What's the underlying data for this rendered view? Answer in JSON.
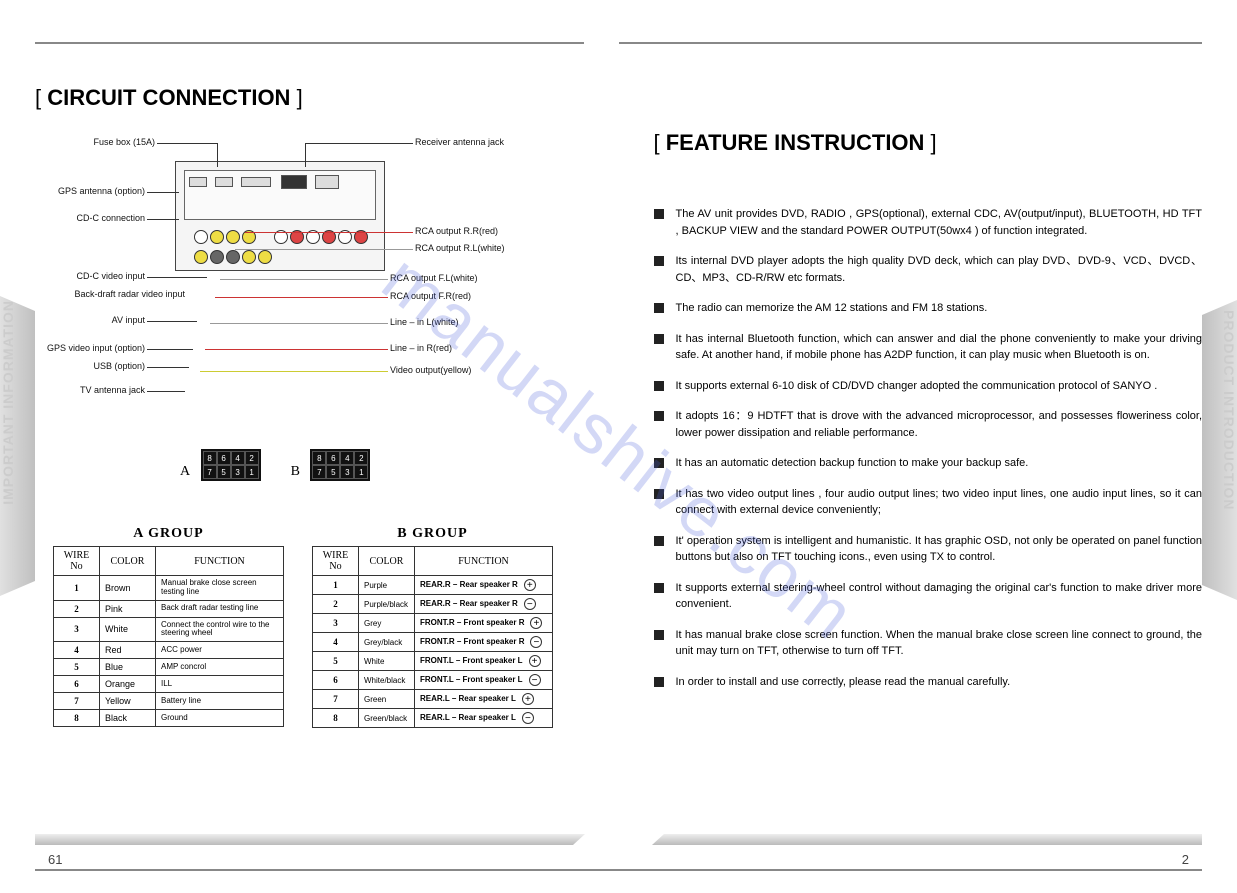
{
  "leftTitle": "CIRCUIT CONNECTION",
  "rightTitle": "FEATURE INSTRUCTION",
  "sideLeft": "IMPORTANT   INFORMATION",
  "sideRight": "PRODUCT INTRODUCTION",
  "pageLeft": "61",
  "pageRight": "2",
  "watermark": "manualshive.com",
  "labelsLeft": [
    "Fuse box (15A)",
    "GPS antenna (option)",
    "CD-C connection",
    "CD-C video input",
    "Back-draft radar video input",
    "AV input",
    "GPS video input (option)",
    "USB (option)",
    "TV antenna jack"
  ],
  "labelsRight": [
    "Receiver antenna jack",
    "RCA output R.R(red)",
    "RCA output R.L(white)",
    "RCA output F.L(white)",
    "RCA output F.R(red)",
    "Line – in L(white)",
    "Line – in R(red)",
    "Video output(yellow)"
  ],
  "connA": "A",
  "connB": "B",
  "pinsTop": [
    "8",
    "6",
    "4",
    "2"
  ],
  "pinsBot": [
    "7",
    "5",
    "3",
    "1"
  ],
  "groupA": {
    "title": "A GROUP",
    "headers": [
      "WIRE No",
      "COLOR",
      "FUNCTION"
    ],
    "rows": [
      {
        "no": "1",
        "color": "Brown",
        "func": "Manual brake close screen testing line"
      },
      {
        "no": "2",
        "color": "Pink",
        "func": "Back draft radar testing line"
      },
      {
        "no": "3",
        "color": "White",
        "func": "Connect the control wire to the steering wheel"
      },
      {
        "no": "4",
        "color": "Red",
        "func": "ACC power"
      },
      {
        "no": "5",
        "color": "Blue",
        "func": "AMP concrol"
      },
      {
        "no": "6",
        "color": "Orange",
        "func": "ILL"
      },
      {
        "no": "7",
        "color": "Yellow",
        "func": "Battery line"
      },
      {
        "no": "8",
        "color": "Black",
        "func": "Ground"
      }
    ]
  },
  "groupB": {
    "title": "B GROUP",
    "headers": [
      "WIRE No",
      "COLOR",
      "FUNCTION"
    ],
    "rows": [
      {
        "no": "1",
        "color": "Purple",
        "func": "REAR.R – Rear speaker R",
        "sym": "+"
      },
      {
        "no": "2",
        "color": "Purple/black",
        "func": "REAR.R – Rear speaker R",
        "sym": "−"
      },
      {
        "no": "3",
        "color": "Grey",
        "func": "FRONT.R – Front speaker R",
        "sym": "+"
      },
      {
        "no": "4",
        "color": "Grey/black",
        "func": "FRONT.R – Front speaker R",
        "sym": "−"
      },
      {
        "no": "5",
        "color": "White",
        "func": "FRONT.L – Front speaker L",
        "sym": "+"
      },
      {
        "no": "6",
        "color": "White/black",
        "func": "FRONT.L – Front speaker L",
        "sym": "−"
      },
      {
        "no": "7",
        "color": "Green",
        "func": "REAR.L – Rear speaker L",
        "sym": "+"
      },
      {
        "no": "8",
        "color": "Green/black",
        "func": "REAR.L – Rear speaker L",
        "sym": "−"
      }
    ]
  },
  "features": [
    "The AV unit provides DVD, RADIO , GPS(optional), external CDC, AV(output/input), BLUETOOTH, HD TFT , BACKUP VIEW and the standard POWER OUTPUT(50wx4 ) of function integrated.",
    "Its internal DVD player adopts the high quality DVD deck, which can play DVD、DVD-9、VCD、DVCD、CD、MP3、CD-R/RW etc formats.",
    "The radio can memorize the AM 12 stations and FM 18 stations.",
    "It has internal Bluetooth function, which can answer and dial the phone conveniently to make your driving safe. At another hand, if mobile phone has A2DP function, it can play music when Bluetooth is on.",
    "It supports external 6-10 disk of CD/DVD changer adopted the communication protocol of SANYO .",
    "It adopts 16：9 HDTFT that is drove with the advanced microprocessor, and possesses floweriness color, lower power dissipation and reliable performance.",
    "It has an automatic detection backup function to make your backup safe.",
    "It has two video output lines , four audio output lines; two video input lines, one audio input lines, so it can connect with external device conveniently;",
    "It' operation system is intelligent and humanistic. It has graphic OSD, not only be operated on panel function buttons but also on TFT touching icons., even using TX to control.",
    "It supports external steering-wheel control without damaging the original car's function to make driver more convenient.",
    "It has manual brake close screen function. When the manual brake close screen line connect to ground, the unit may turn on TFT, otherwise to turn off TFT.",
    "In order to install and use correctly, please read the manual carefully."
  ]
}
